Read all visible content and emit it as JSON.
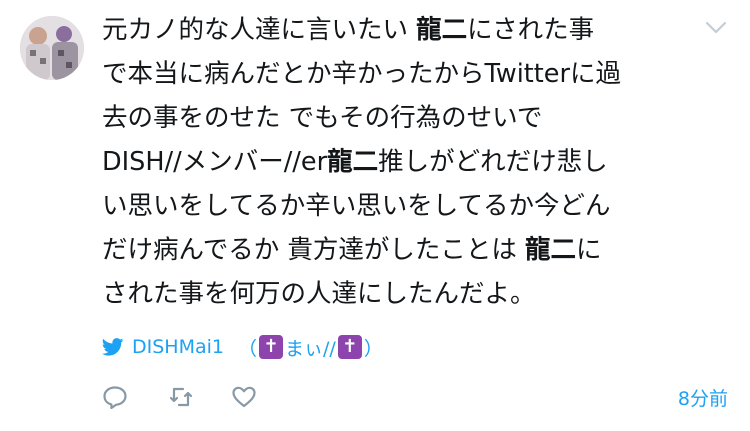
{
  "tweet": {
    "lines": [
      [
        {
          "text": "元カノ的な人達に言いたい "
        },
        {
          "text": "龍二",
          "bold": true
        },
        {
          "text": "にされた事"
        }
      ],
      [
        {
          "text": "で本当に病んだとか辛かったからTwitterに過"
        }
      ],
      [
        {
          "text": "去の事をのせた でもその行為のせいで"
        }
      ],
      [
        {
          "text": "DISH//メンバー//er"
        },
        {
          "text": "龍二",
          "bold": true
        },
        {
          "text": "推しがどれだけ悲し"
        }
      ],
      [
        {
          "text": "い思いをしてるか辛い思いをしてるか今どん"
        }
      ],
      [
        {
          "text": "だけ病んでるか 貴方達がしたことは "
        },
        {
          "text": "龍二",
          "bold": true
        },
        {
          "text": "に"
        }
      ],
      [
        {
          "text": "された事を何万の人達にしたんだよ。"
        }
      ]
    ]
  },
  "source": {
    "username": "DISHMai1",
    "open_paren": "（",
    "cross": "✝",
    "name_text": "まぃ//",
    "close_paren": "）"
  },
  "timestamp": "8分前",
  "colors": {
    "text": "#14171a",
    "accent": "#1da1f2",
    "icon_gray": "#8899a6",
    "cross_bg": "#8e44ad"
  },
  "icons": {
    "caret": "chevron-down-icon",
    "bird": "twitter-bird-icon",
    "reply": "reply-icon",
    "retweet": "retweet-icon",
    "like": "heart-icon"
  }
}
